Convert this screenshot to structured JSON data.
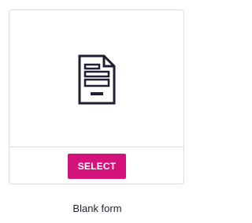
{
  "template_card": {
    "icon": "form-document-icon",
    "select_label": "SELECT",
    "caption": "Blank form"
  },
  "colors": {
    "accent": "#d3127b",
    "icon_stroke": "#1f1f33",
    "border": "#dcdcdc",
    "caption_text": "#1f1f2e"
  }
}
